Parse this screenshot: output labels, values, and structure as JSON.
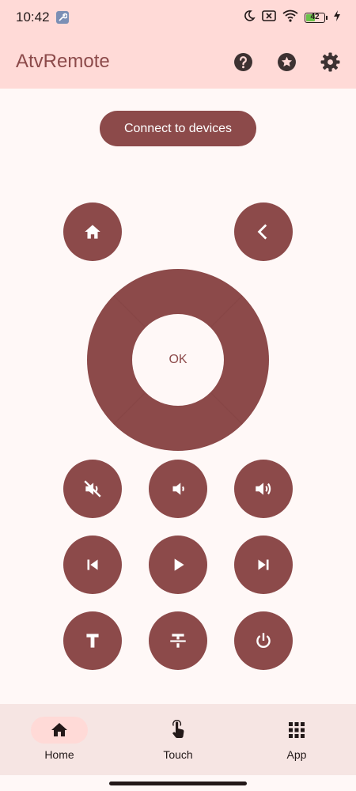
{
  "status_bar": {
    "time": "10:42",
    "battery_level": "42",
    "icons": [
      "wrench-icon",
      "moon-icon",
      "no-sim-icon",
      "wifi-icon",
      "battery-icon",
      "charging-icon"
    ]
  },
  "app_bar": {
    "title": "AtvRemote",
    "actions": [
      "help-icon",
      "star-icon",
      "settings-icon"
    ]
  },
  "connect_button": {
    "label": "Connect to devices"
  },
  "remote": {
    "ok_label": "OK",
    "buttons": [
      "home",
      "back",
      "mute",
      "volume-down",
      "volume-up",
      "previous",
      "play",
      "next",
      "text-input",
      "strikethrough",
      "power"
    ]
  },
  "bottom_nav": {
    "items": [
      {
        "label": "Home",
        "icon": "home-icon",
        "active": true
      },
      {
        "label": "Touch",
        "icon": "touch-icon",
        "active": false
      },
      {
        "label": "App",
        "icon": "apps-grid-icon",
        "active": false
      }
    ]
  },
  "colors": {
    "accent": "#8c4a4a",
    "header_bg": "#ffdad7",
    "page_bg": "#fff8f7",
    "nav_bg": "#f6e5e3"
  }
}
